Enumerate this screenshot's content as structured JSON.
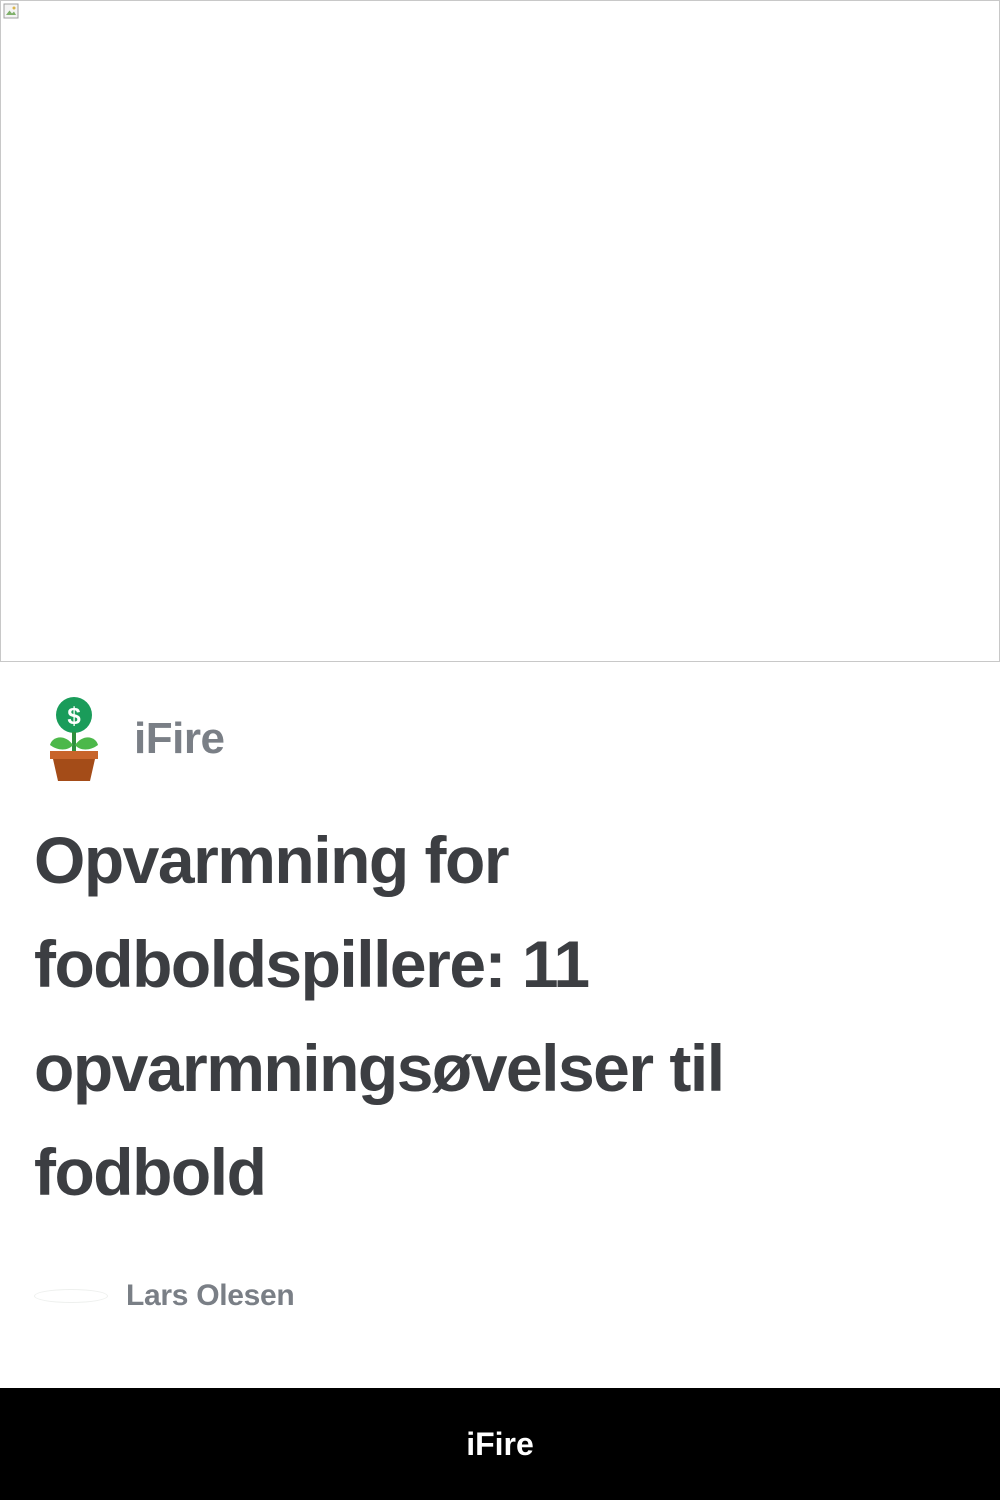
{
  "hero": {
    "icon": "broken-image-icon"
  },
  "publisher": {
    "logo_icon": "money-plant-icon",
    "name": "iFire"
  },
  "article": {
    "title": "Opvarmning for fodboldspillere: 11 opvarmningsøvelser til fodbold"
  },
  "author": {
    "name": "Lars Olesen"
  },
  "footer": {
    "brand": "iFire"
  },
  "colors": {
    "title": "#3c3e42",
    "muted": "#7a7f86",
    "footer_bg": "#000000",
    "footer_text": "#ffffff",
    "logo_green": "#1a9c5a",
    "logo_pot": "#b8581e"
  }
}
